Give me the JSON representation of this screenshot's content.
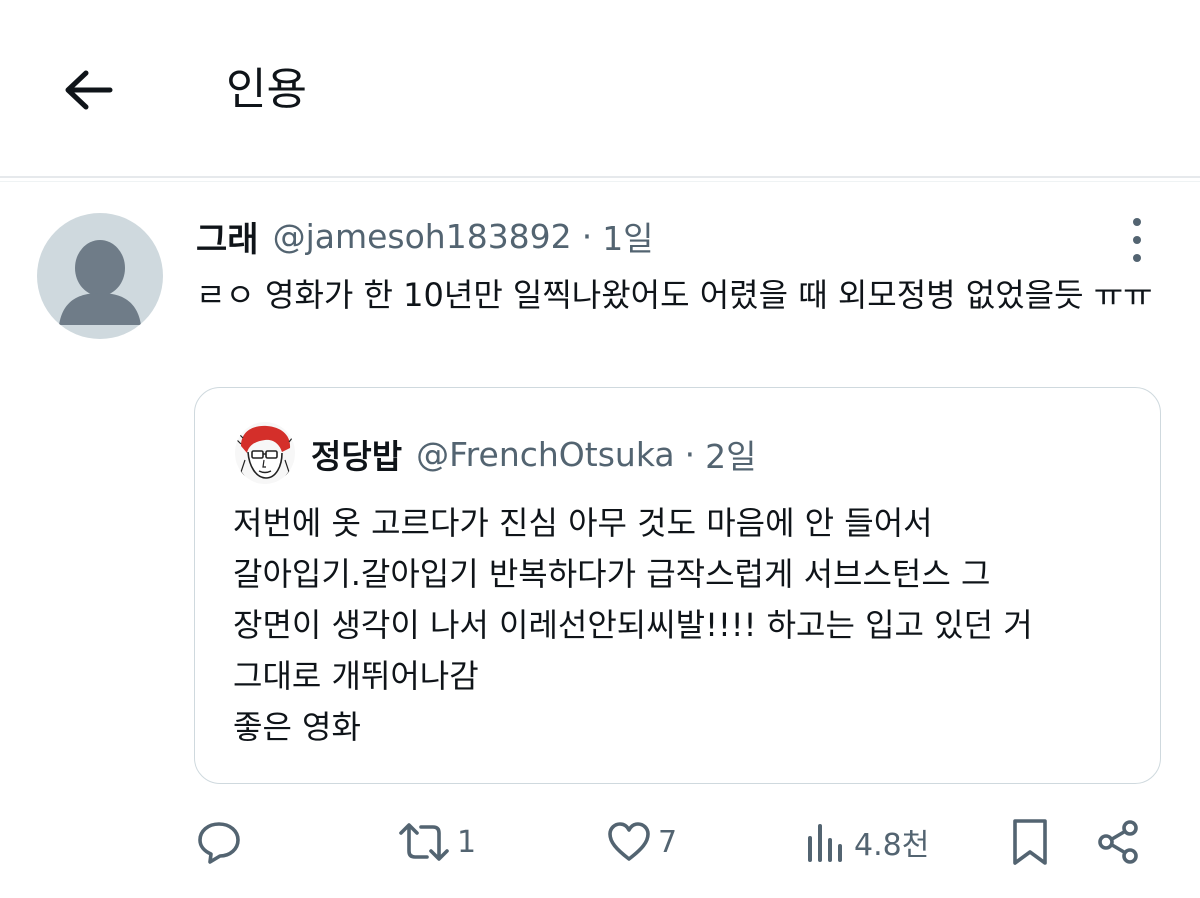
{
  "header": {
    "back_icon": "arrow-left-icon",
    "title": "인용"
  },
  "tweet": {
    "avatar_icon": "default-user-avatar",
    "display_name": "그래",
    "handle": "@jamesoh183892",
    "separator": "·",
    "time": "1일",
    "more_icon": "vertical-ellipsis-icon",
    "text": "ㄹㅇ 영화가 한 10년만 일찍나왔어도 어렸을 때 외모정병 없었을듯 ㅠㅠ"
  },
  "quoted_tweet": {
    "display_name": "정당밥",
    "handle": "@FrenchOtsuka",
    "separator": "·",
    "time": "2일",
    "lines": [
      "저번에 옷 고르다가 진심 아무 것도 마음에 안 들어서",
      "갈아입기.갈아입기 반복하다가 급작스럽게 서브스턴스 그",
      "장면이 생각이 나서 이레선안되씨발!!!! 하고는 입고 있던 거",
      "그대로 개뛰어나감",
      "좋은 영화"
    ]
  },
  "actions": {
    "reply_icon": "reply-bubble-icon",
    "retweet_icon": "retweet-icon",
    "retweet_count": "1",
    "like_icon": "heart-icon",
    "like_count": "7",
    "views_icon": "bar-chart-icon",
    "views_count": "4.8천",
    "bookmark_icon": "bookmark-icon",
    "share_icon": "share-icon"
  },
  "colors": {
    "text_primary": "#0f1419",
    "text_secondary": "#536471",
    "border": "#cfd9de",
    "avatar_bg": "#cfd9de",
    "avatar_fg": "#6f7c88"
  }
}
